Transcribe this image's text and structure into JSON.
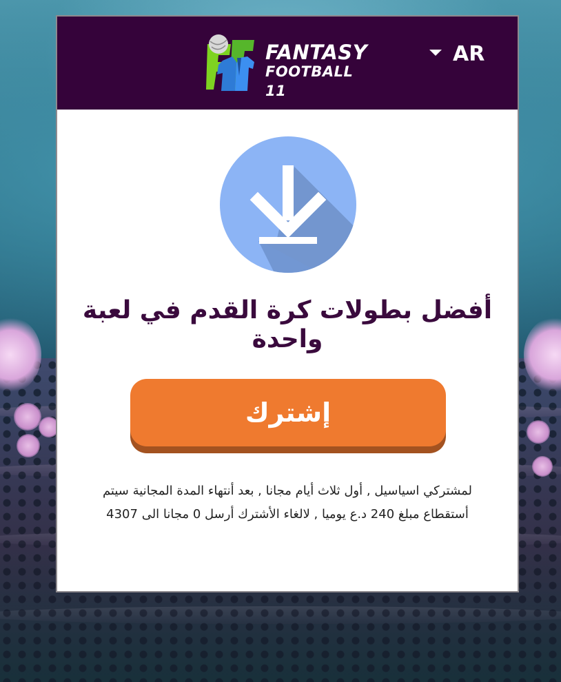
{
  "header": {
    "logo_line1": "FANTASY",
    "logo_line2": "FOOTBALL 11",
    "language_label": "AR",
    "background_color": "#35033a"
  },
  "main": {
    "download_icon": "download-icon",
    "title": "أفضل بطولات كرة القدم في لعبة واحدة",
    "subscribe_label": "إشترك",
    "subscribe_color": "#ef7a2f",
    "terms_text": "لمشتركي اسياسيل , أول ثلاث أيام مجانا , بعد أنتهاء المدة المجانية سيتم أستقطاع مبلغ 240 د.ع يوميا , لالغاء الأشترك أرسل 0 مجانا الى 4307"
  }
}
